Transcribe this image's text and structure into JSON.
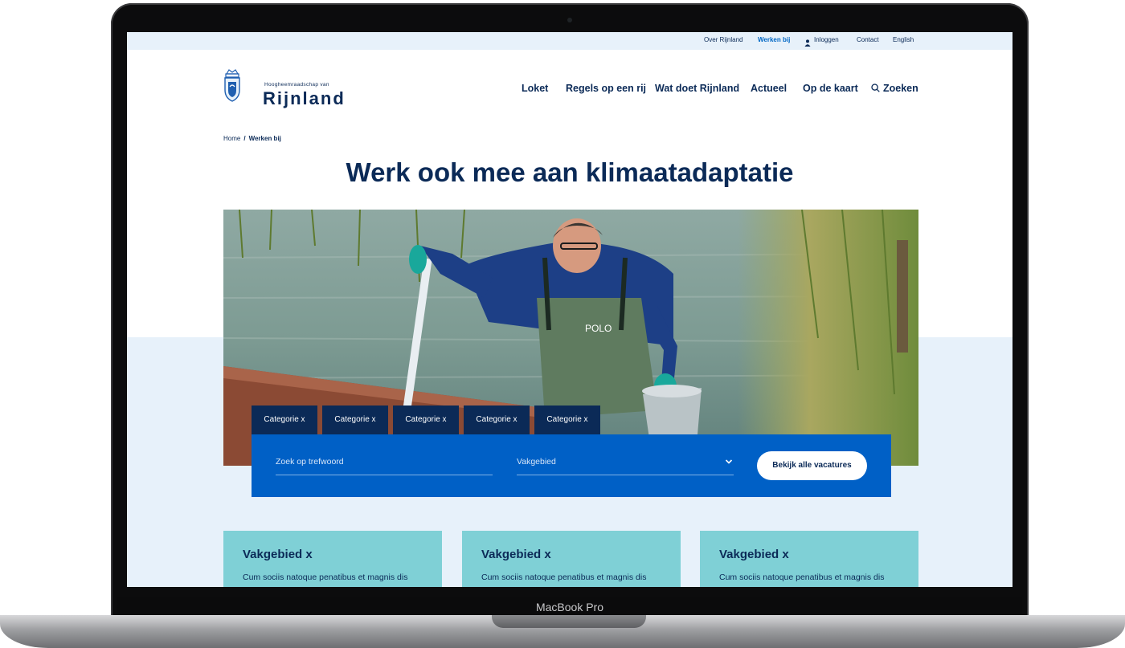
{
  "device": {
    "label": "MacBook Pro"
  },
  "topbar": {
    "links": [
      {
        "label": "Over Rijnland",
        "active": false
      },
      {
        "label": "Werken bij",
        "active": true
      },
      {
        "label": "Inloggen",
        "active": false
      },
      {
        "label": "Contact",
        "active": false
      },
      {
        "label": "English",
        "active": false
      }
    ]
  },
  "logo": {
    "subtitle": "Hoogheemraadschap van",
    "name": "Rijnland"
  },
  "nav": {
    "items": [
      "Loket",
      "Regels op een rij",
      "Wat doet Rijnland",
      "Actueel",
      "Op de kaart"
    ],
    "search_label": "Zoeken"
  },
  "breadcrumb": {
    "home": "Home",
    "separator": "/",
    "current": "Werken bij"
  },
  "page": {
    "title": "Werk ook mee aan klimaatadaptatie"
  },
  "hero": {
    "shirt_logo": "POLO"
  },
  "filter": {
    "tags": [
      "Categorie x",
      "Categorie x",
      "Categorie x",
      "Categorie x",
      "Categorie x"
    ],
    "keyword_placeholder": "Zoek op trefwoord",
    "select_value": "Vakgebied",
    "button_label": "Bekijk alle vacatures"
  },
  "cards": [
    {
      "title": "Vakgebied x",
      "text": "Cum sociis natoque penatibus et magnis dis"
    },
    {
      "title": "Vakgebied x",
      "text": "Cum sociis natoque penatibus et magnis dis"
    },
    {
      "title": "Vakgebied x",
      "text": "Cum sociis natoque penatibus et magnis dis"
    }
  ],
  "colors": {
    "navy": "#0b2a57",
    "blue": "#0060c6",
    "light": "#e7f1fa",
    "teal": "#7fd0d6"
  }
}
